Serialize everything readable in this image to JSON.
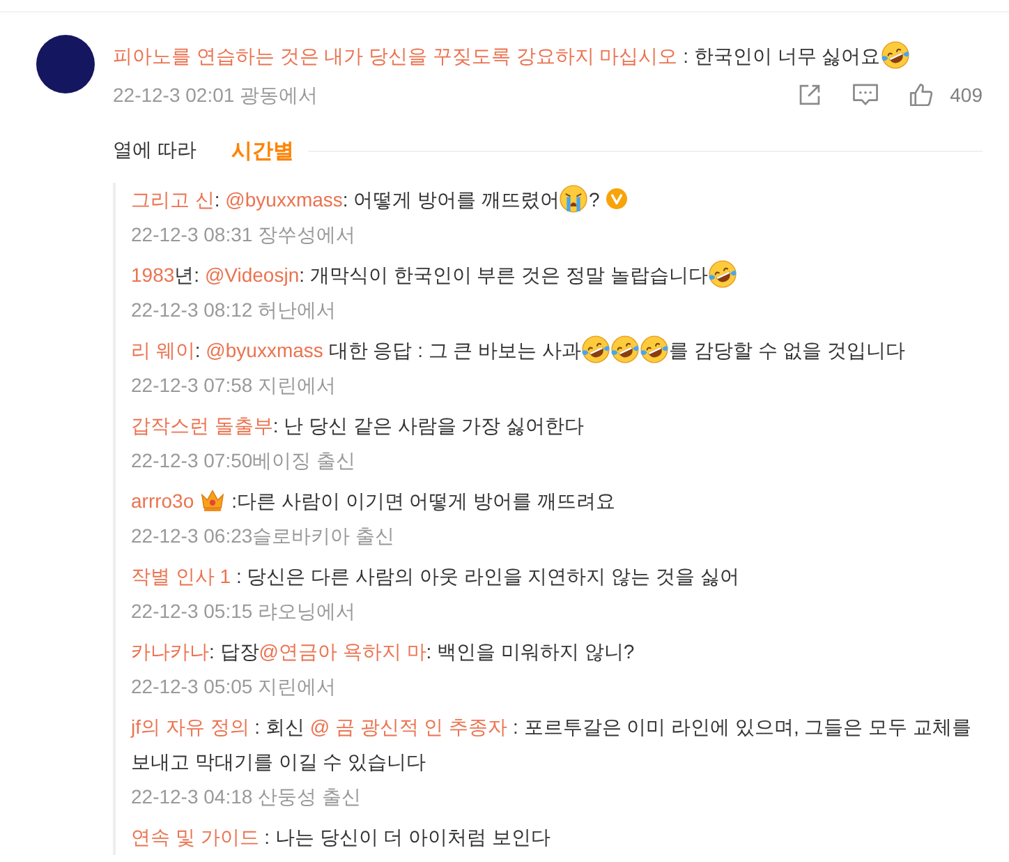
{
  "comment": {
    "content": [
      {
        "kind": "link",
        "text": "피아노를 연습하는 것은 내가 당신을 꾸짖도록 강요하지 마십시오"
      },
      {
        "kind": "text",
        "text": " : 한국인이 너무 싫어요"
      },
      {
        "kind": "laugh"
      }
    ],
    "meta": "22-12-3 02:01 광동에서",
    "like_count": "409"
  },
  "sort_tabs": [
    {
      "label": "열에 따라",
      "selected": false
    },
    {
      "label": "시간별",
      "selected": true
    }
  ],
  "replies": [
    {
      "content": [
        {
          "kind": "link",
          "text": "그리고 신"
        },
        {
          "kind": "text",
          "text": ": "
        },
        {
          "kind": "link",
          "text": "@byuxxmass"
        },
        {
          "kind": "text",
          "text": ": 어떻게 방어를 깨뜨렸어"
        },
        {
          "kind": "cry"
        },
        {
          "kind": "text",
          "text": "?"
        },
        {
          "kind": "badge"
        }
      ],
      "meta": "22-12-3 08:31 장쑤성에서"
    },
    {
      "content": [
        {
          "kind": "link",
          "text": "1983"
        },
        {
          "kind": "text",
          "text": "년: "
        },
        {
          "kind": "link",
          "text": "@Videosjn"
        },
        {
          "kind": "text",
          "text": ": 개막식이 한국인이 부른 것은 정말 놀랍습니다"
        },
        {
          "kind": "laugh"
        }
      ],
      "meta": "22-12-3 08:12 허난에서"
    },
    {
      "content": [
        {
          "kind": "link",
          "text": "리 웨이"
        },
        {
          "kind": "text",
          "text": ": "
        },
        {
          "kind": "link",
          "text": "@byuxxmass"
        },
        {
          "kind": "text",
          "text": " 대한 응답 : 그 큰 바보는 사과"
        },
        {
          "kind": "laugh"
        },
        {
          "kind": "laugh"
        },
        {
          "kind": "laugh"
        },
        {
          "kind": "text",
          "text": "를 감당할 수 없을 것입니다"
        }
      ],
      "meta": "22-12-3 07:58 지린에서"
    },
    {
      "content": [
        {
          "kind": "link",
          "text": "갑작스런 돌출부"
        },
        {
          "kind": "text",
          "text": ": 난 당신 같은 사람을 가장 싫어한다"
        }
      ],
      "meta": "22-12-3 07:50베이징 출신"
    },
    {
      "content": [
        {
          "kind": "link",
          "text": "arrro3o"
        },
        {
          "kind": "crown"
        },
        {
          "kind": "text",
          "text": ":다른 사람이 이기면 어떻게 방어를 깨뜨려요"
        }
      ],
      "meta": "22-12-3 06:23슬로바키아 출신"
    },
    {
      "content": [
        {
          "kind": "link",
          "text": "작별 인사 1"
        },
        {
          "kind": "text",
          "text": " : 당신은 다른 사람의 아웃 라인을 지연하지 않는 것을 싫어"
        }
      ],
      "meta": "22-12-3 05:15 랴오닝에서"
    },
    {
      "content": [
        {
          "kind": "link",
          "text": "카나카나"
        },
        {
          "kind": "text",
          "text": ": 답장"
        },
        {
          "kind": "link",
          "text": "@연금아 욕하지 마"
        },
        {
          "kind": "text",
          "text": ": 백인을 미워하지 않니?"
        }
      ],
      "meta": "22-12-3 05:05 지린에서"
    },
    {
      "content": [
        {
          "kind": "link",
          "text": "jf의 자유 정의"
        },
        {
          "kind": "text",
          "text": " : 회신 "
        },
        {
          "kind": "link",
          "text": "@ 곰 광신적 인 추종자"
        },
        {
          "kind": "text",
          "text": " : 포르투갈은 이미 라인에 있으며, 그들은 모두 교체를 보내고 막대기를 이길 수 있습니다"
        }
      ],
      "meta": "22-12-3 04:18 산둥성 출신"
    },
    {
      "content": [
        {
          "kind": "link",
          "text": "연속 및 가이드"
        },
        {
          "kind": "text",
          "text": " : 나는 당신이 더 아이처럼 보인다"
        }
      ]
    }
  ]
}
